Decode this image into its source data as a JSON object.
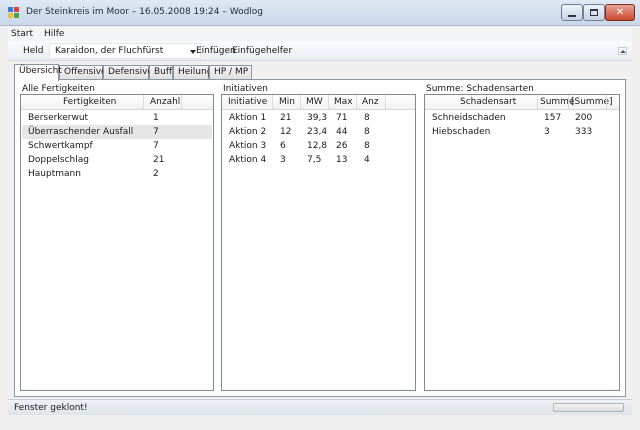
{
  "window": {
    "title": "Der Steinkreis im Moor – 16.05.2008 19:24 – Wodlog"
  },
  "menu": {
    "items": [
      "Start",
      "Hilfe"
    ]
  },
  "toolbar": {
    "held_label": "Held",
    "held_value": "Karaidon, der Fluchfürst",
    "einfuegen_label": "Einfügen",
    "einfuegehelfer_label": "Einfügehelfer"
  },
  "tabs": [
    {
      "label": "Übersicht",
      "active": true
    },
    {
      "label": "Offensive",
      "active": false
    },
    {
      "label": "Defensive",
      "active": false
    },
    {
      "label": "Buff",
      "active": false
    },
    {
      "label": "Heilung",
      "active": false
    },
    {
      "label": "HP / MP",
      "active": false
    }
  ],
  "fertigkeiten": {
    "group_label": "Alle Fertigkeiten",
    "columns": [
      "Fertigkeiten",
      "Anzahl"
    ],
    "rows": [
      {
        "name": "Berserkerwut",
        "anzahl": "1",
        "selected": false
      },
      {
        "name": "Überraschender Ausfall",
        "anzahl": "7",
        "selected": true
      },
      {
        "name": "Schwertkampf",
        "anzahl": "7",
        "selected": false
      },
      {
        "name": "Doppelschlag",
        "anzahl": "21",
        "selected": false
      },
      {
        "name": "Hauptmann",
        "anzahl": "2",
        "selected": false
      }
    ]
  },
  "initiativen": {
    "group_label": "Initiativen",
    "columns": [
      "Initiative",
      "Min",
      "MW",
      "Max",
      "Anz"
    ],
    "rows": [
      [
        "Aktion 1",
        "21",
        "39,3",
        "71",
        "8"
      ],
      [
        "Aktion 2",
        "12",
        "23,4",
        "44",
        "8"
      ],
      [
        "Aktion 3",
        "6",
        "12,8",
        "26",
        "8"
      ],
      [
        "Aktion 4",
        "3",
        "7,5",
        "13",
        "4"
      ]
    ]
  },
  "schadensarten": {
    "group_label": "Summe: Schadensarten",
    "columns": [
      "Schadensart",
      "Summe",
      "[Summe]"
    ],
    "rows": [
      [
        "Schneidschaden",
        "157",
        "200"
      ],
      [
        "Hiebschaden",
        "3",
        "333"
      ]
    ]
  },
  "status": {
    "text": "Fenster geklont!",
    "progress": 0
  },
  "colors": {
    "titlebar": "#c9d7e8",
    "close_button": "#c8492f",
    "selected_row": "#e6e6e6"
  }
}
